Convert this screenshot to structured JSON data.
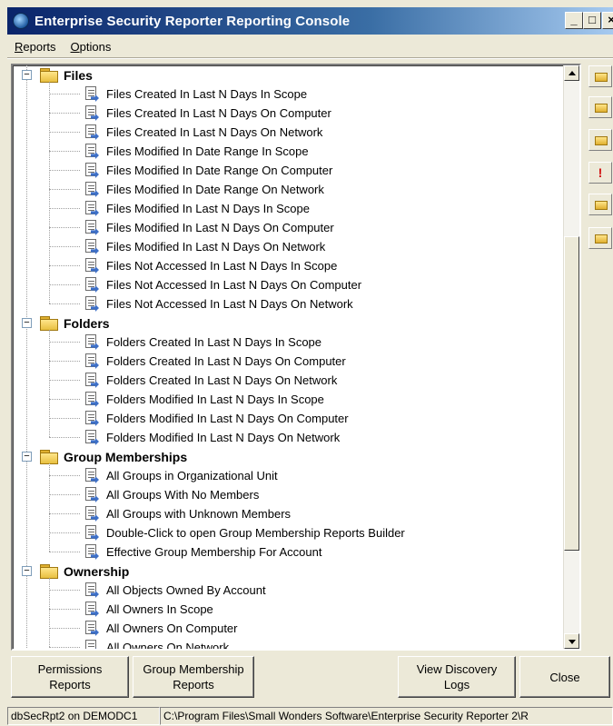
{
  "window": {
    "title": "Enterprise Security Reporter Reporting Console",
    "controls": {
      "minimize": "_",
      "maximize": "□",
      "close": "×"
    }
  },
  "menu": {
    "reports_label": "Reports",
    "options_label": "Options"
  },
  "tree": {
    "groups": [
      {
        "label": "Files",
        "expander": "−",
        "items": [
          "Files Created In Last N Days In Scope",
          "Files Created In Last N Days On Computer",
          "Files Created In Last N Days On Network",
          "Files Modified In Date Range In Scope",
          "Files Modified In Date Range On Computer",
          "Files Modified In Date Range On Network",
          "Files Modified In Last N Days In Scope",
          "Files Modified In Last N Days On Computer",
          "Files Modified In Last N Days On Network",
          "Files Not Accessed In Last N Days In Scope",
          "Files Not Accessed In Last N Days On Computer",
          "Files Not Accessed In Last N Days On Network"
        ]
      },
      {
        "label": "Folders",
        "expander": "−",
        "items": [
          "Folders Created In Last N Days In Scope",
          "Folders Created In Last N Days On Computer",
          "Folders Created In Last N Days On Network",
          "Folders Modified In Last N Days In Scope",
          "Folders Modified In Last N Days On Computer",
          "Folders Modified In Last N Days On Network"
        ]
      },
      {
        "label": "Group Memberships",
        "expander": "−",
        "items": [
          "All Groups in Organizational Unit",
          "All Groups With No Members",
          "All Groups with Unknown Members",
          "Double-Click to open Group Membership Reports Builder",
          "Effective Group Membership For Account"
        ]
      },
      {
        "label": "Ownership",
        "expander": "−",
        "items": [
          "All Objects Owned By Account",
          "All Owners In Scope",
          "All Owners On Computer",
          "All Owners On Network"
        ]
      }
    ]
  },
  "toolbar": {
    "buttons": [
      {
        "icon": "new-folder-icon"
      },
      {
        "icon": "open-folder-icon"
      },
      {
        "icon": "delete-folder-icon"
      },
      {
        "icon": "exclamation-icon",
        "glyph": "!"
      },
      {
        "icon": "edit-report-icon"
      },
      {
        "icon": "properties-icon"
      }
    ]
  },
  "buttons": {
    "permissions_line1": "Permissions",
    "permissions_line2": "Reports",
    "group_line1": "Group Membership",
    "group_line2": "Reports",
    "discovery_line1": "View Discovery",
    "discovery_line2": "Logs",
    "close": "Close"
  },
  "status": {
    "connection": "dbSecRpt2 on DEMODC1",
    "path": "C:\\Program Files\\Small Wonders Software\\Enterprise Security Reporter 2\\R"
  },
  "colors": {
    "titlebar_start": "#0a246a",
    "titlebar_end": "#a6caf0",
    "face": "#ece9d8"
  }
}
